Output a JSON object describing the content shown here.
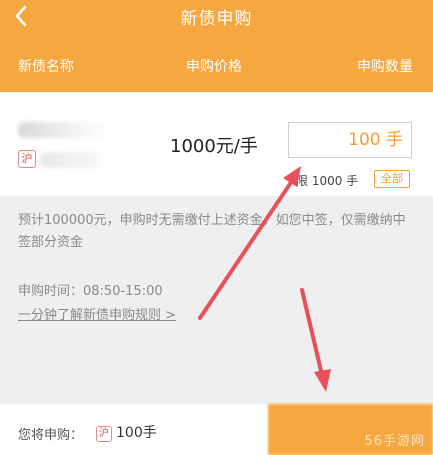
{
  "header": {
    "title": "新债申购",
    "columns": [
      "新债名称",
      "申购价格",
      "申购数量"
    ]
  },
  "bond": {
    "exchange_badge": "沪",
    "price": "1000元/手",
    "quantity": "100 手",
    "limit": "限 1000 手",
    "all_label": "全部"
  },
  "info": {
    "note": "预计100000元，申购时无需缴付上述资金。如您中签，仅需缴纳中签部分资金",
    "time": "申购时间：08:50-15:00",
    "rules_link": "一分钟了解新债申购规则 >"
  },
  "footer": {
    "will_label": "您将申购：",
    "badge": "沪",
    "quantity": "100手",
    "watermark": "56手游网"
  },
  "colors": {
    "brand": "#f7a73f",
    "arrow": "#e8505b"
  }
}
